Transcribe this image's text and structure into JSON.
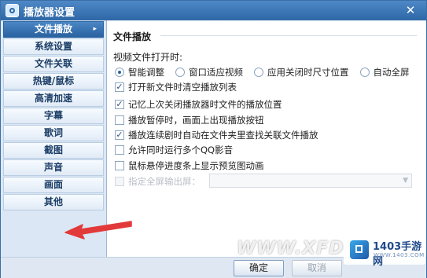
{
  "window": {
    "title": "播放器设置",
    "close_glyph": "✕"
  },
  "sidebar": {
    "active_chevron": "▸",
    "items": [
      {
        "label": "文件播放"
      },
      {
        "label": "系统设置"
      },
      {
        "label": "文件关联"
      },
      {
        "label": "热键/鼠标"
      },
      {
        "label": "高清加速"
      },
      {
        "label": "字幕"
      },
      {
        "label": "歌词"
      },
      {
        "label": "截图"
      },
      {
        "label": "声音"
      },
      {
        "label": "画面"
      },
      {
        "label": "其他"
      }
    ]
  },
  "main": {
    "section_title": "文件播放",
    "open_label": "视频文件打开时:",
    "radios": [
      {
        "label": "智能调整",
        "checked": true
      },
      {
        "label": "窗口适应视频",
        "checked": false
      },
      {
        "label": "应用关闭时尺寸位置",
        "checked": false
      },
      {
        "label": "自动全屏",
        "checked": false
      }
    ],
    "checkboxes": [
      {
        "label": "打开新文件时清空播放列表",
        "checked": true
      },
      {
        "label": "记忆上次关闭播放器时文件的播放位置",
        "checked": true
      },
      {
        "label": "播放暂停时，画面上出现播放按钮",
        "checked": false
      },
      {
        "label": "播放连续剧时自动在文件夹里查找关联文件播放",
        "checked": true
      },
      {
        "label": "允许同时运行多个QQ影音",
        "checked": false
      },
      {
        "label": "鼠标悬停进度条上显示预览图动画",
        "checked": false
      }
    ],
    "fullscreen_output": {
      "label": "指定全屏输出屏：",
      "checked": false,
      "disabled": true,
      "value": ""
    }
  },
  "footer": {
    "ok_label": "确定",
    "cancel_label": "取消"
  },
  "overlay": {
    "watermark": "WWW.XFDO",
    "badge_text": "1403手游网",
    "badge_sub": "WWW.1403.COM"
  },
  "colors": {
    "titlebar": "#2e67a6",
    "active_item": "#2a62a0",
    "arrow": "#e23a3a"
  }
}
